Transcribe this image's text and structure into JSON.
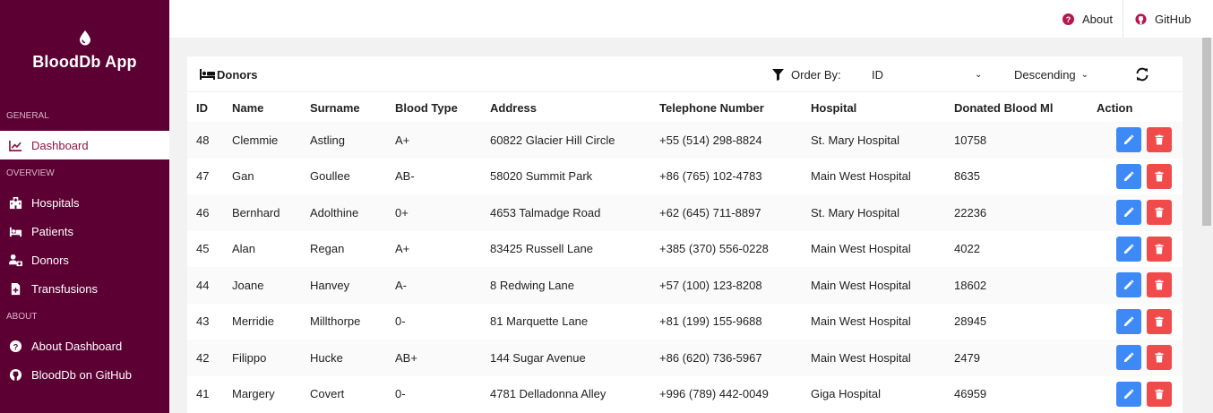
{
  "app": {
    "title": "BloodDb App"
  },
  "sidebar": {
    "sections": [
      {
        "label": "GENERAL"
      },
      {
        "label": "OVERVIEW"
      },
      {
        "label": "ABOUT"
      }
    ],
    "items": [
      {
        "label": "Dashboard",
        "icon": "chart-line-icon",
        "active": true
      },
      {
        "label": "Hospitals",
        "icon": "hospital-icon"
      },
      {
        "label": "Patients",
        "icon": "bed-icon"
      },
      {
        "label": "Donors",
        "icon": "donor-icon"
      },
      {
        "label": "Transfusions",
        "icon": "file-medical-icon"
      },
      {
        "label": "About Dashboard",
        "icon": "question-circle-icon"
      },
      {
        "label": "BloodDb on GitHub",
        "icon": "github-icon"
      }
    ]
  },
  "topbar": {
    "about_label": "About",
    "github_label": "GitHub"
  },
  "card": {
    "title": "Donors",
    "order_by_label": "Order By:",
    "order_by_value": "ID",
    "direction_value": "Descending"
  },
  "table": {
    "headers": [
      "ID",
      "Name",
      "Surname",
      "Blood Type",
      "Address",
      "Telephone Number",
      "Hospital",
      "Donated Blood Ml",
      "Action"
    ],
    "rows": [
      [
        "48",
        "Clemmie",
        "Astling",
        "A+",
        "60822 Glacier Hill Circle",
        "+55 (514) 298-8824",
        "St. Mary Hospital",
        "10758"
      ],
      [
        "47",
        "Gan",
        "Goullee",
        "AB-",
        "58020 Summit Park",
        "+86 (765) 102-4783",
        "Main West Hospital",
        "8635"
      ],
      [
        "46",
        "Bernhard",
        "Adolthine",
        "0+",
        "4653 Talmadge Road",
        "+62 (645) 711-8897",
        "St. Mary Hospital",
        "22236"
      ],
      [
        "45",
        "Alan",
        "Regan",
        "A+",
        "83425 Russell Lane",
        "+385 (370) 556-0228",
        "Main West Hospital",
        "4022"
      ],
      [
        "44",
        "Joane",
        "Hanvey",
        "A-",
        "8 Redwing Lane",
        "+57 (100) 123-8208",
        "Main West Hospital",
        "18602"
      ],
      [
        "43",
        "Merridie",
        "Millthorpe",
        "0-",
        "81 Marquette Lane",
        "+81 (199) 155-9688",
        "Main West Hospital",
        "28945"
      ],
      [
        "42",
        "Filippo",
        "Hucke",
        "AB+",
        "144 Sugar Avenue",
        "+86 (620) 736-5967",
        "Main West Hospital",
        "2479"
      ],
      [
        "41",
        "Margery",
        "Covert",
        "0-",
        "4781 Delladonna Alley",
        "+996 (789) 442-0049",
        "Giga Hospital",
        "46959"
      ]
    ]
  },
  "colors": {
    "sidebar_bg": "#5c0033",
    "active_text": "#8a1745",
    "edit_button": "#3d8af7",
    "delete_button": "#f14a4a",
    "about_icon": "#b5174f"
  }
}
